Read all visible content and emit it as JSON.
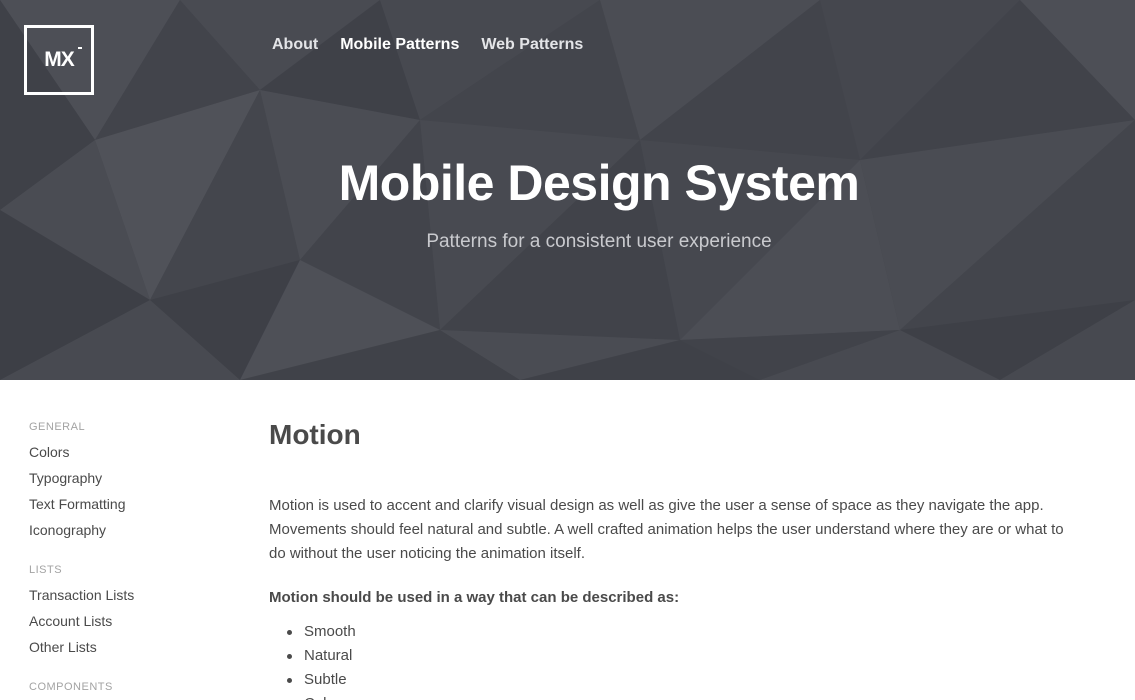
{
  "brand": {
    "logo_text": "MX"
  },
  "nav": [
    {
      "label": "About",
      "active": false
    },
    {
      "label": "Mobile Patterns",
      "active": true
    },
    {
      "label": "Web Patterns",
      "active": false
    }
  ],
  "hero": {
    "title": "Mobile Design System",
    "subtitle": "Patterns for a consistent user experience"
  },
  "sidebar": {
    "groups": [
      {
        "heading": "GENERAL",
        "items": [
          "Colors",
          "Typography",
          "Text Formatting",
          "Iconography"
        ]
      },
      {
        "heading": "LISTS",
        "items": [
          "Transaction Lists",
          "Account Lists",
          "Other Lists"
        ]
      },
      {
        "heading": "COMPONENTS",
        "items": []
      }
    ]
  },
  "content": {
    "title": "Motion",
    "intro": "Motion is used to accent and clarify visual design as well as give the user a sense of space as they navigate the app. Movements should feel natural and subtle. A well crafted animation helps the user understand where they are or what to do without the user noticing the animation itself.",
    "subheading": "Motion should be used in a way that can be described as:",
    "bullets": [
      "Smooth",
      "Natural",
      "Subtle",
      "Calm"
    ]
  },
  "colors": {
    "hero_bg": "#45474e",
    "text": "#4a4a4a",
    "muted": "#a3a3a3"
  }
}
